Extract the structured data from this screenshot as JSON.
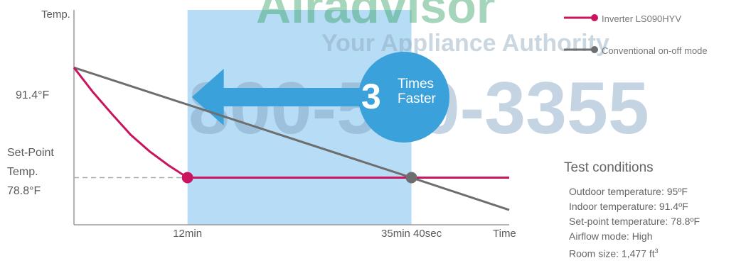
{
  "watermark": {
    "logo_text": "Airadvisor",
    "tagline": "Your Appliance Authority",
    "phone": "800-570-3355"
  },
  "badge": {
    "number": "3",
    "line1": "Times",
    "line2": "Faster"
  },
  "chart_data": {
    "type": "line",
    "ylabel": "Temp.",
    "xlabel": "Time",
    "y_ticks": [
      {
        "value": 91.4,
        "label": "91.4°F"
      },
      {
        "value": 78.8,
        "label_lines": [
          "Set-Point",
          "Temp.",
          "78.8°F"
        ]
      }
    ],
    "x_ticks": [
      {
        "value": 12,
        "label": "12min"
      },
      {
        "value": 35.67,
        "label": "35min 40sec"
      }
    ],
    "xlim": [
      0,
      46
    ],
    "ylim": [
      73.4,
      98.0
    ],
    "highlight_region": [
      12,
      35.67
    ],
    "series": [
      {
        "name": "Inverter LS090HYV",
        "color": "#c8155e",
        "points": [
          [
            0,
            91.4
          ],
          [
            2,
            88.6
          ],
          [
            4,
            86.1
          ],
          [
            6,
            83.7
          ],
          [
            8,
            81.8
          ],
          [
            10,
            80.2
          ],
          [
            12,
            78.8
          ],
          [
            35.67,
            78.8
          ],
          [
            46,
            78.8
          ]
        ],
        "marker": [
          12,
          78.8
        ]
      },
      {
        "name": "Conventional on-off mode",
        "color": "#6e6e6e",
        "points": [
          [
            0,
            91.4
          ],
          [
            35.67,
            78.8
          ],
          [
            46,
            75.1
          ]
        ],
        "marker": [
          35.67,
          78.8
        ]
      }
    ],
    "setpoint_line": 78.8,
    "colors": {
      "highlight": "#b7dcf5",
      "arrow": "#3aa1db",
      "badge": "#3aa1db",
      "axis": "#9a9a9a"
    }
  },
  "test_conditions": {
    "title": "Test conditions",
    "items": [
      "Outdoor temperature: 95ºF",
      "Indoor temperature: 91.4ºF",
      "Set-point temperature: 78.8ºF",
      "Airflow mode: High"
    ],
    "room_size_label": "Room size: 1,477 ft",
    "room_size_sup": "3"
  }
}
